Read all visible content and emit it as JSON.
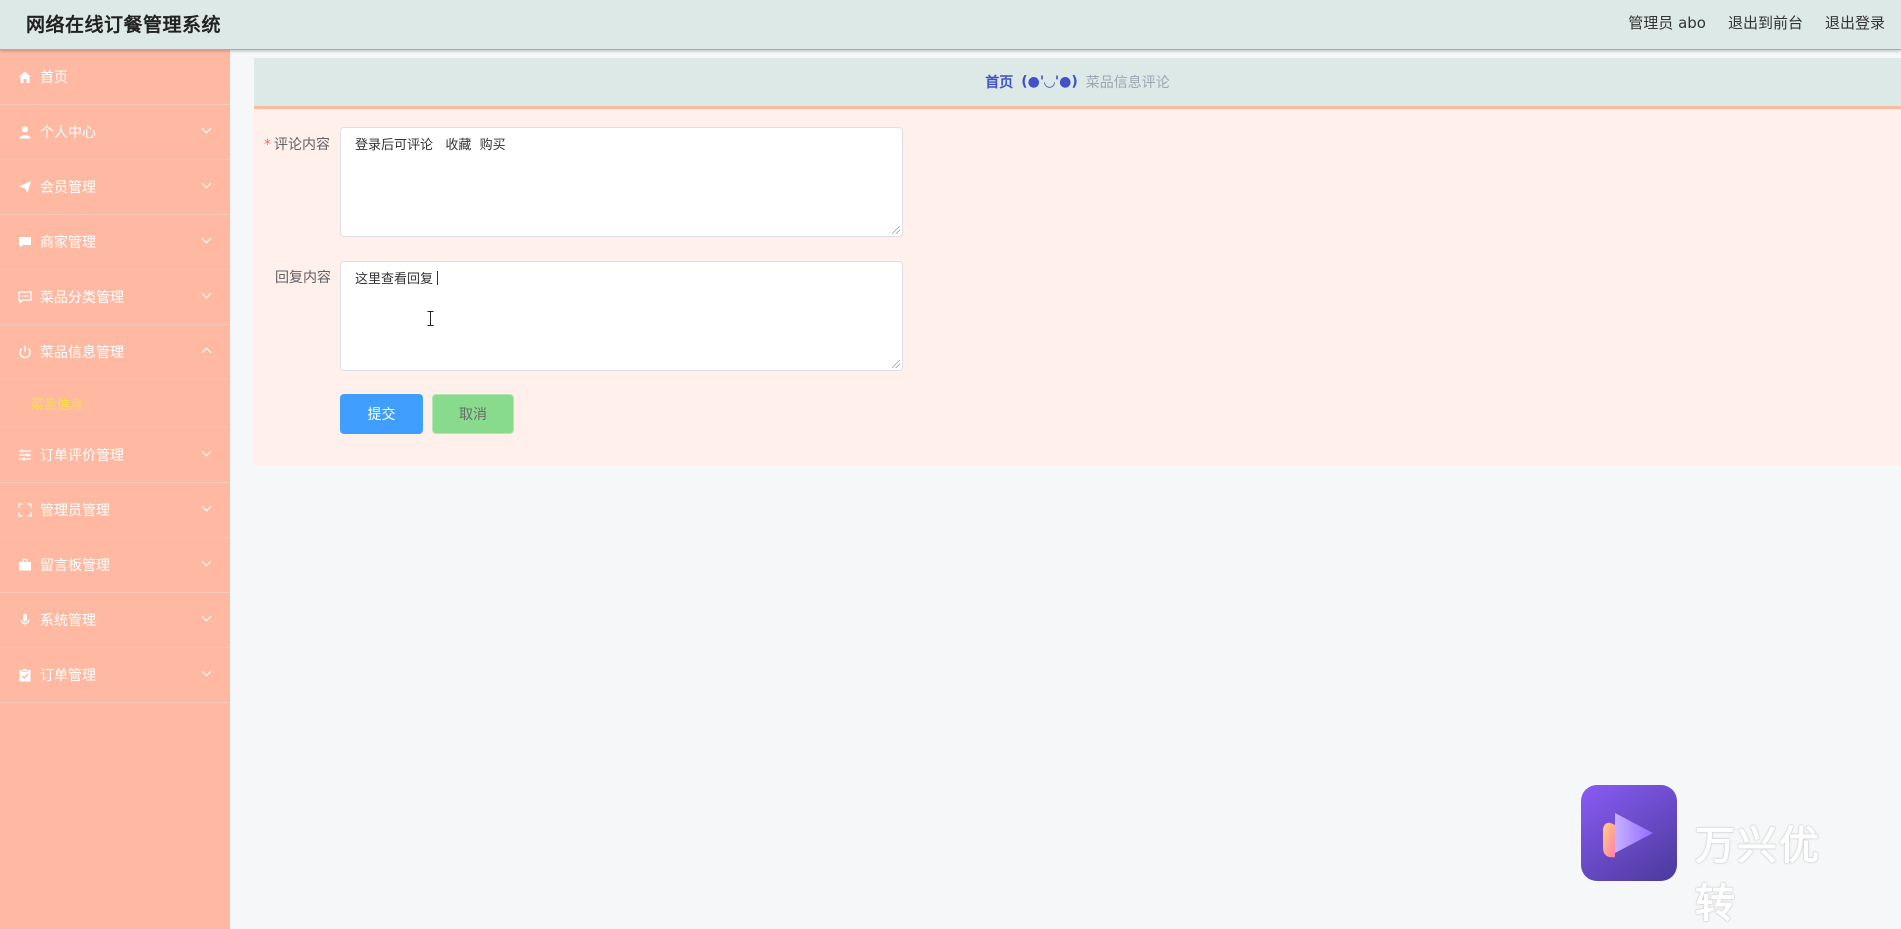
{
  "app": {
    "title": "网络在线订餐管理系统"
  },
  "header": {
    "links": [
      "管理员 abo",
      "退出到前台",
      "退出登录"
    ]
  },
  "sidebar": {
    "items": [
      {
        "label": "首页",
        "icon": "home-icon",
        "has_submenu": false
      },
      {
        "label": "个人中心",
        "icon": "user-icon",
        "has_submenu": true
      },
      {
        "label": "会员管理",
        "icon": "paper-plane-icon",
        "has_submenu": true
      },
      {
        "label": "商家管理",
        "icon": "chat-bubble-icon",
        "has_submenu": true
      },
      {
        "label": "菜品分类管理",
        "icon": "chat-dots-icon",
        "has_submenu": true
      },
      {
        "label": "菜品信息管理",
        "icon": "power-icon",
        "has_submenu": true,
        "expanded": true,
        "children": [
          {
            "label": "菜品信息",
            "active": true
          }
        ]
      },
      {
        "label": "订单评价管理",
        "icon": "sliders-icon",
        "has_submenu": true
      },
      {
        "label": "管理员管理",
        "icon": "fullscreen-icon",
        "has_submenu": true
      },
      {
        "label": "留言板管理",
        "icon": "briefcase-icon",
        "has_submenu": true
      },
      {
        "label": "系统管理",
        "icon": "microphone-icon",
        "has_submenu": true
      },
      {
        "label": "订单管理",
        "icon": "clipboard-check-icon",
        "has_submenu": true
      }
    ]
  },
  "breadcrumb": {
    "home": "首页",
    "separator": "(●'◡'●)",
    "current": "菜品信息评论"
  },
  "form": {
    "comment": {
      "label": "评论内容",
      "required": true,
      "value": "登录后可评论   收藏  购买"
    },
    "reply": {
      "label": "回复内容",
      "required": false,
      "value": "这里查看回复"
    },
    "submit_label": "提交",
    "cancel_label": "取消"
  },
  "watermark": {
    "text": "万兴优转"
  },
  "colors": {
    "header_bg": "#dde9e6",
    "sidebar_bg": "#ffb9a2",
    "active_submenu": "#f8e33c",
    "form_panel_bg": "#fff0ec",
    "submit": "#409eff",
    "cancel": "#88da8c",
    "breadcrumb_link": "#4152c9"
  }
}
